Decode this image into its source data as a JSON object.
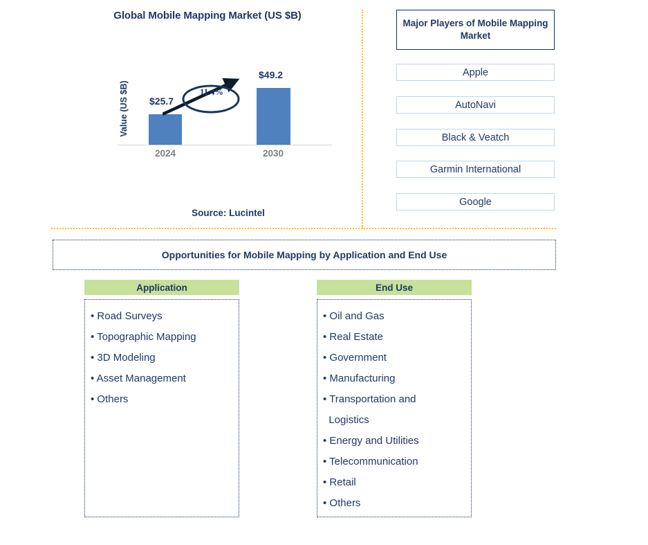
{
  "chart_panel": {
    "title": "Global Mobile Mapping Market (US $B)",
    "y_axis_label": "Value (US $B)",
    "cagr_label": "11.4%",
    "source_note": "Source: Lucintel"
  },
  "chart_data": {
    "type": "bar",
    "title": "Global Mobile Mapping Market (US $B)",
    "categories": [
      "2024",
      "2030"
    ],
    "values": [
      25.7,
      49.2
    ],
    "value_labels": [
      "$25.7",
      "$49.2"
    ],
    "xlabel": "",
    "ylabel": "Value (US $B)",
    "ylim": [
      0,
      55
    ],
    "grid": false,
    "legend": "none",
    "bar_color": "#4E81BD",
    "annotations": [
      {
        "text": "11.4%",
        "type": "cagr-ellipse-with-arrow",
        "from": "2024",
        "to": "2030"
      }
    ]
  },
  "players_panel": {
    "header": "Major Players of Mobile Mapping Market",
    "items": [
      "Apple",
      "AutoNavi",
      "Black & Veatch",
      "Garmin International",
      "Google"
    ]
  },
  "opportunities": {
    "banner": "Opportunities for Mobile Mapping by Application and End Use",
    "columns": [
      {
        "header": "Application",
        "items": [
          "• Road Surveys",
          "• Topographic Mapping",
          "• 3D Modeling",
          "• Asset Management",
          "• Others"
        ]
      },
      {
        "header": "End Use",
        "items": [
          "• Oil and Gas",
          "• Real Estate",
          "• Government",
          "• Manufacturing",
          "• Transportation and\n  Logistics",
          "• Energy and Utilities",
          "• Telecommunication",
          "• Retail",
          "• Others"
        ]
      }
    ]
  },
  "colors": {
    "navy": "#1F3864",
    "bar_blue": "#4E81BD",
    "accent_orange": "#FFC000",
    "header_green": "#C7E09A",
    "box_border_light_blue": "#BDD7EE"
  }
}
